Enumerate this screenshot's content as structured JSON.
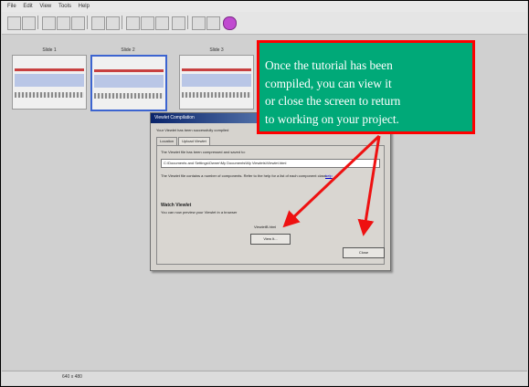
{
  "menu": [
    "File",
    "Edit",
    "View",
    "Tools",
    "Help"
  ],
  "slides": [
    {
      "title": "Slide 1"
    },
    {
      "title": "Slide 2"
    },
    {
      "title": "Slide 3"
    }
  ],
  "dialog": {
    "title": "Viewlet Compilation",
    "status_message": "Your Viewlet has been successfully compiled",
    "tabs": [
      "Location",
      "Upload Viewlet"
    ],
    "location_text": "The Viewlet file has been compressed and saved to:",
    "path": "C:\\Documents and Settings\\Owner\\My Documents\\My Viewlets\\Viewlet.html",
    "components_text": "The Viewlet file contains a number of components. Refer to the help for a list of each component class.",
    "help_link": "help",
    "watch_heading": "Watch Viewlet",
    "watch_text": "You can now preview your Viewlet in a browser",
    "filename": "ViewletB.html",
    "view_button": "View It...",
    "close_button": "Close"
  },
  "statusbar": {
    "size": "640 x 480"
  },
  "callout": {
    "lines": [
      "Once the tutorial has been",
      "compiled, you can view it",
      "or close the screen to return",
      "to working on your project."
    ],
    "color": "#00a978",
    "border_color": "#ff0000"
  }
}
